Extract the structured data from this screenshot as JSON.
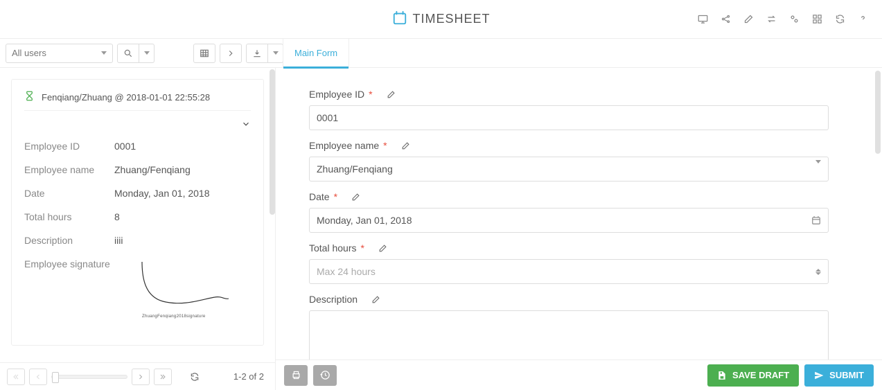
{
  "header": {
    "title": "TIMESHEET"
  },
  "toolbar": {
    "user_filter": "All users"
  },
  "tabs": {
    "main_form": "Main Form"
  },
  "record": {
    "title": "Fenqiang/Zhuang @ 2018-01-01 22:55:28",
    "labels": {
      "employee_id": "Employee ID",
      "employee_name": "Employee name",
      "date": "Date",
      "total_hours": "Total hours",
      "description": "Description",
      "signature": "Employee signature"
    },
    "values": {
      "employee_id": "0001",
      "employee_name": "Zhuang/Fenqiang",
      "date": "Monday, Jan 01, 2018",
      "total_hours": "8",
      "description": "iiii"
    }
  },
  "pagination": {
    "info": "1-2 of 2"
  },
  "form": {
    "labels": {
      "employee_id": "Employee ID",
      "employee_name": "Employee name",
      "date": "Date",
      "total_hours": "Total hours",
      "description": "Description"
    },
    "values": {
      "employee_id": "0001",
      "employee_name": "Zhuang/Fenqiang",
      "date": "Monday, Jan 01, 2018"
    },
    "placeholders": {
      "total_hours": "Max 24 hours"
    }
  },
  "footer": {
    "save_draft": "SAVE DRAFT",
    "submit": "SUBMIT"
  }
}
